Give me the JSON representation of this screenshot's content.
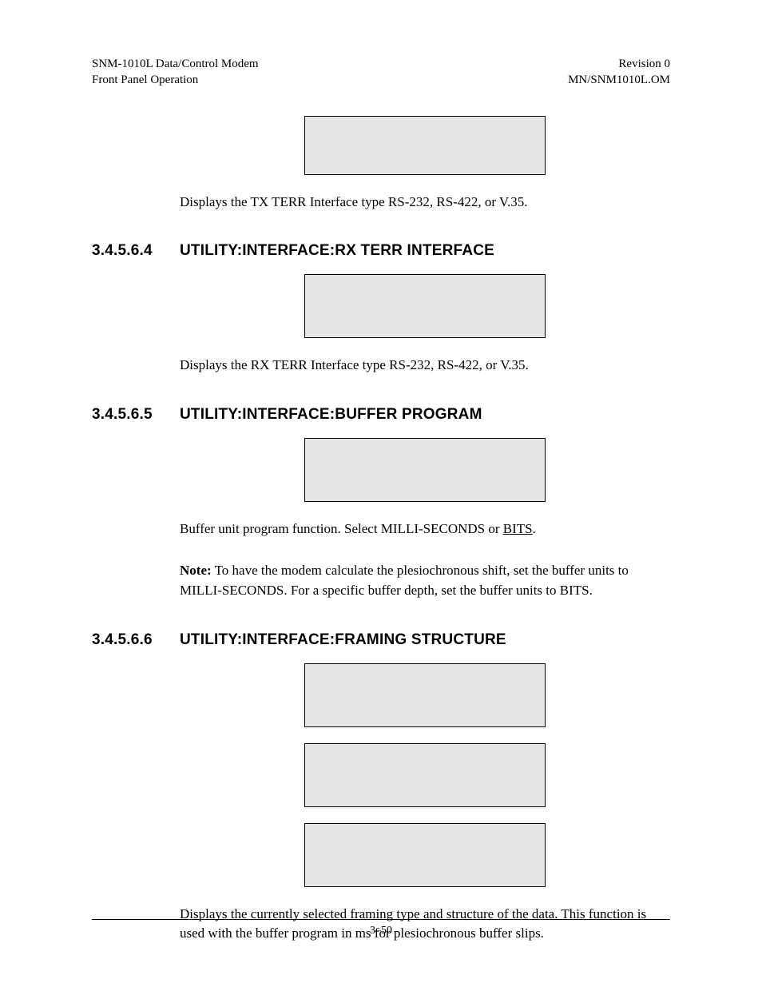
{
  "header": {
    "left_line1": "SNM-1010L Data/Control Modem",
    "left_line2": "Front Panel Operation",
    "right_line1": "Revision 0",
    "right_line2": "MN/SNM1010L.OM"
  },
  "intro_paragraph": "Displays the TX TERR Interface type RS-232, RS-422, or V.35.",
  "sections": [
    {
      "number": "3.4.5.6.4",
      "title": "UTILITY:INTERFACE:RX TERR INTERFACE",
      "paragraphs": [
        "Displays the RX TERR Interface type RS-232, RS-422, or V.35."
      ]
    },
    {
      "number": "3.4.5.6.5",
      "title": "UTILITY:INTERFACE:BUFFER PROGRAM",
      "buffer_prefix": "Buffer unit program function. Select MILLI-SECONDS or ",
      "buffer_underlined": "BITS",
      "buffer_suffix": ".",
      "note_label": "Note:",
      "note_text": " To have the modem calculate the plesiochronous shift, set the buffer units to MILLI-SECONDS. For a specific buffer depth, set the buffer units to BITS."
    },
    {
      "number": "3.4.5.6.6",
      "title": "UTILITY:INTERFACE:FRAMING STRUCTURE",
      "paragraphs": [
        "Displays the currently selected framing type and structure of the data. This function is used with the buffer program in ms for plesiochronous buffer slips."
      ]
    }
  ],
  "footer": {
    "page_number": "3–50"
  }
}
